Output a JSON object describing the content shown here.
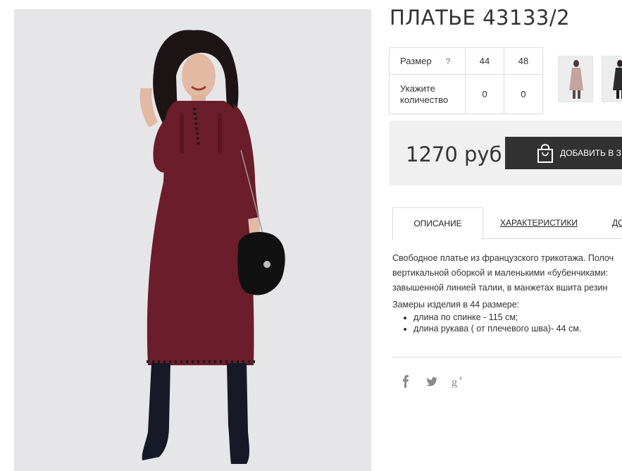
{
  "product": {
    "title": "ПЛАТЬЕ 43133/2"
  },
  "sizes": {
    "size_label": "Размер",
    "help_mark": "?",
    "size_values": [
      "44",
      "48"
    ],
    "qty_label_line1": "Укажите",
    "qty_label_line2": "количество",
    "qty_values": [
      "0",
      "0"
    ]
  },
  "price": {
    "text": "1270 руб",
    "cart_label": "ДОБАВИТЬ В З"
  },
  "tabs": [
    {
      "label": "ОПИСАНИЕ",
      "active": true
    },
    {
      "label": "ХАРАКТЕРИСТИКИ",
      "active": false
    },
    {
      "label": "ДО",
      "active": false
    }
  ],
  "description": {
    "lines": [
      "Свободное платье из французского трикотажа. Полоч",
      "вертикальной оборкой и маленькими «бубенчиками:",
      "завышенной линией талии, в манжетах вшита резин"
    ],
    "measurements_title": "Замеры изделия в 44 размере:",
    "items": [
      "длина по спинке - 115 см;",
      "длина рукава ( от плечевого шва)- 44 см."
    ]
  },
  "social": [
    "facebook-icon",
    "twitter-icon",
    "google-plus-icon"
  ],
  "colors": {
    "dress": "#6b1d2b",
    "button": "#323232",
    "price_bg": "#f0f0f0",
    "photo_bg": "#e6e6e8"
  }
}
